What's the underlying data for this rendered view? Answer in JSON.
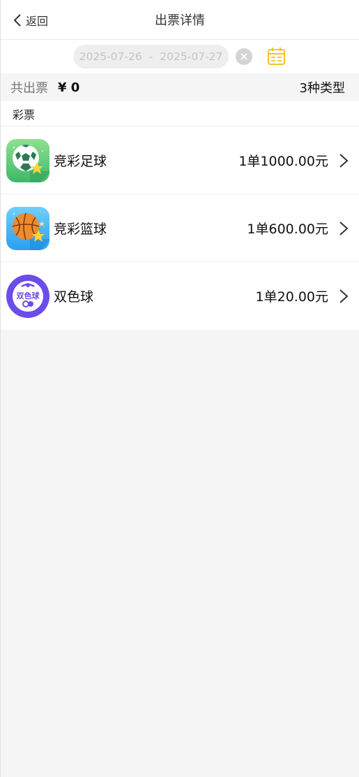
{
  "header": {
    "back_label": "返回",
    "title": "出票详情"
  },
  "date_range": {
    "start": "2025-07-26",
    "separator": "-",
    "end": "2025-07-27"
  },
  "summary": {
    "label": "共出票",
    "amount": "¥ 0",
    "types": "3种类型"
  },
  "section": {
    "title": "彩票"
  },
  "items": [
    {
      "name": "竞彩足球",
      "amount": "1单1000.00元",
      "icon": "soccer-ball-icon"
    },
    {
      "name": "竞彩篮球",
      "amount": "1单600.00元",
      "icon": "basketball-icon"
    },
    {
      "name": "双色球",
      "amount": "1单20.00元",
      "icon": "double-color-ball-icon",
      "icon_text": "双色球"
    }
  ],
  "colors": {
    "accent_yellow": "#f5c02a",
    "soccer_bg": "#5fcf7f",
    "basketball_bg": "#3cb5f5",
    "ssq_bg": "#6b4dea"
  }
}
